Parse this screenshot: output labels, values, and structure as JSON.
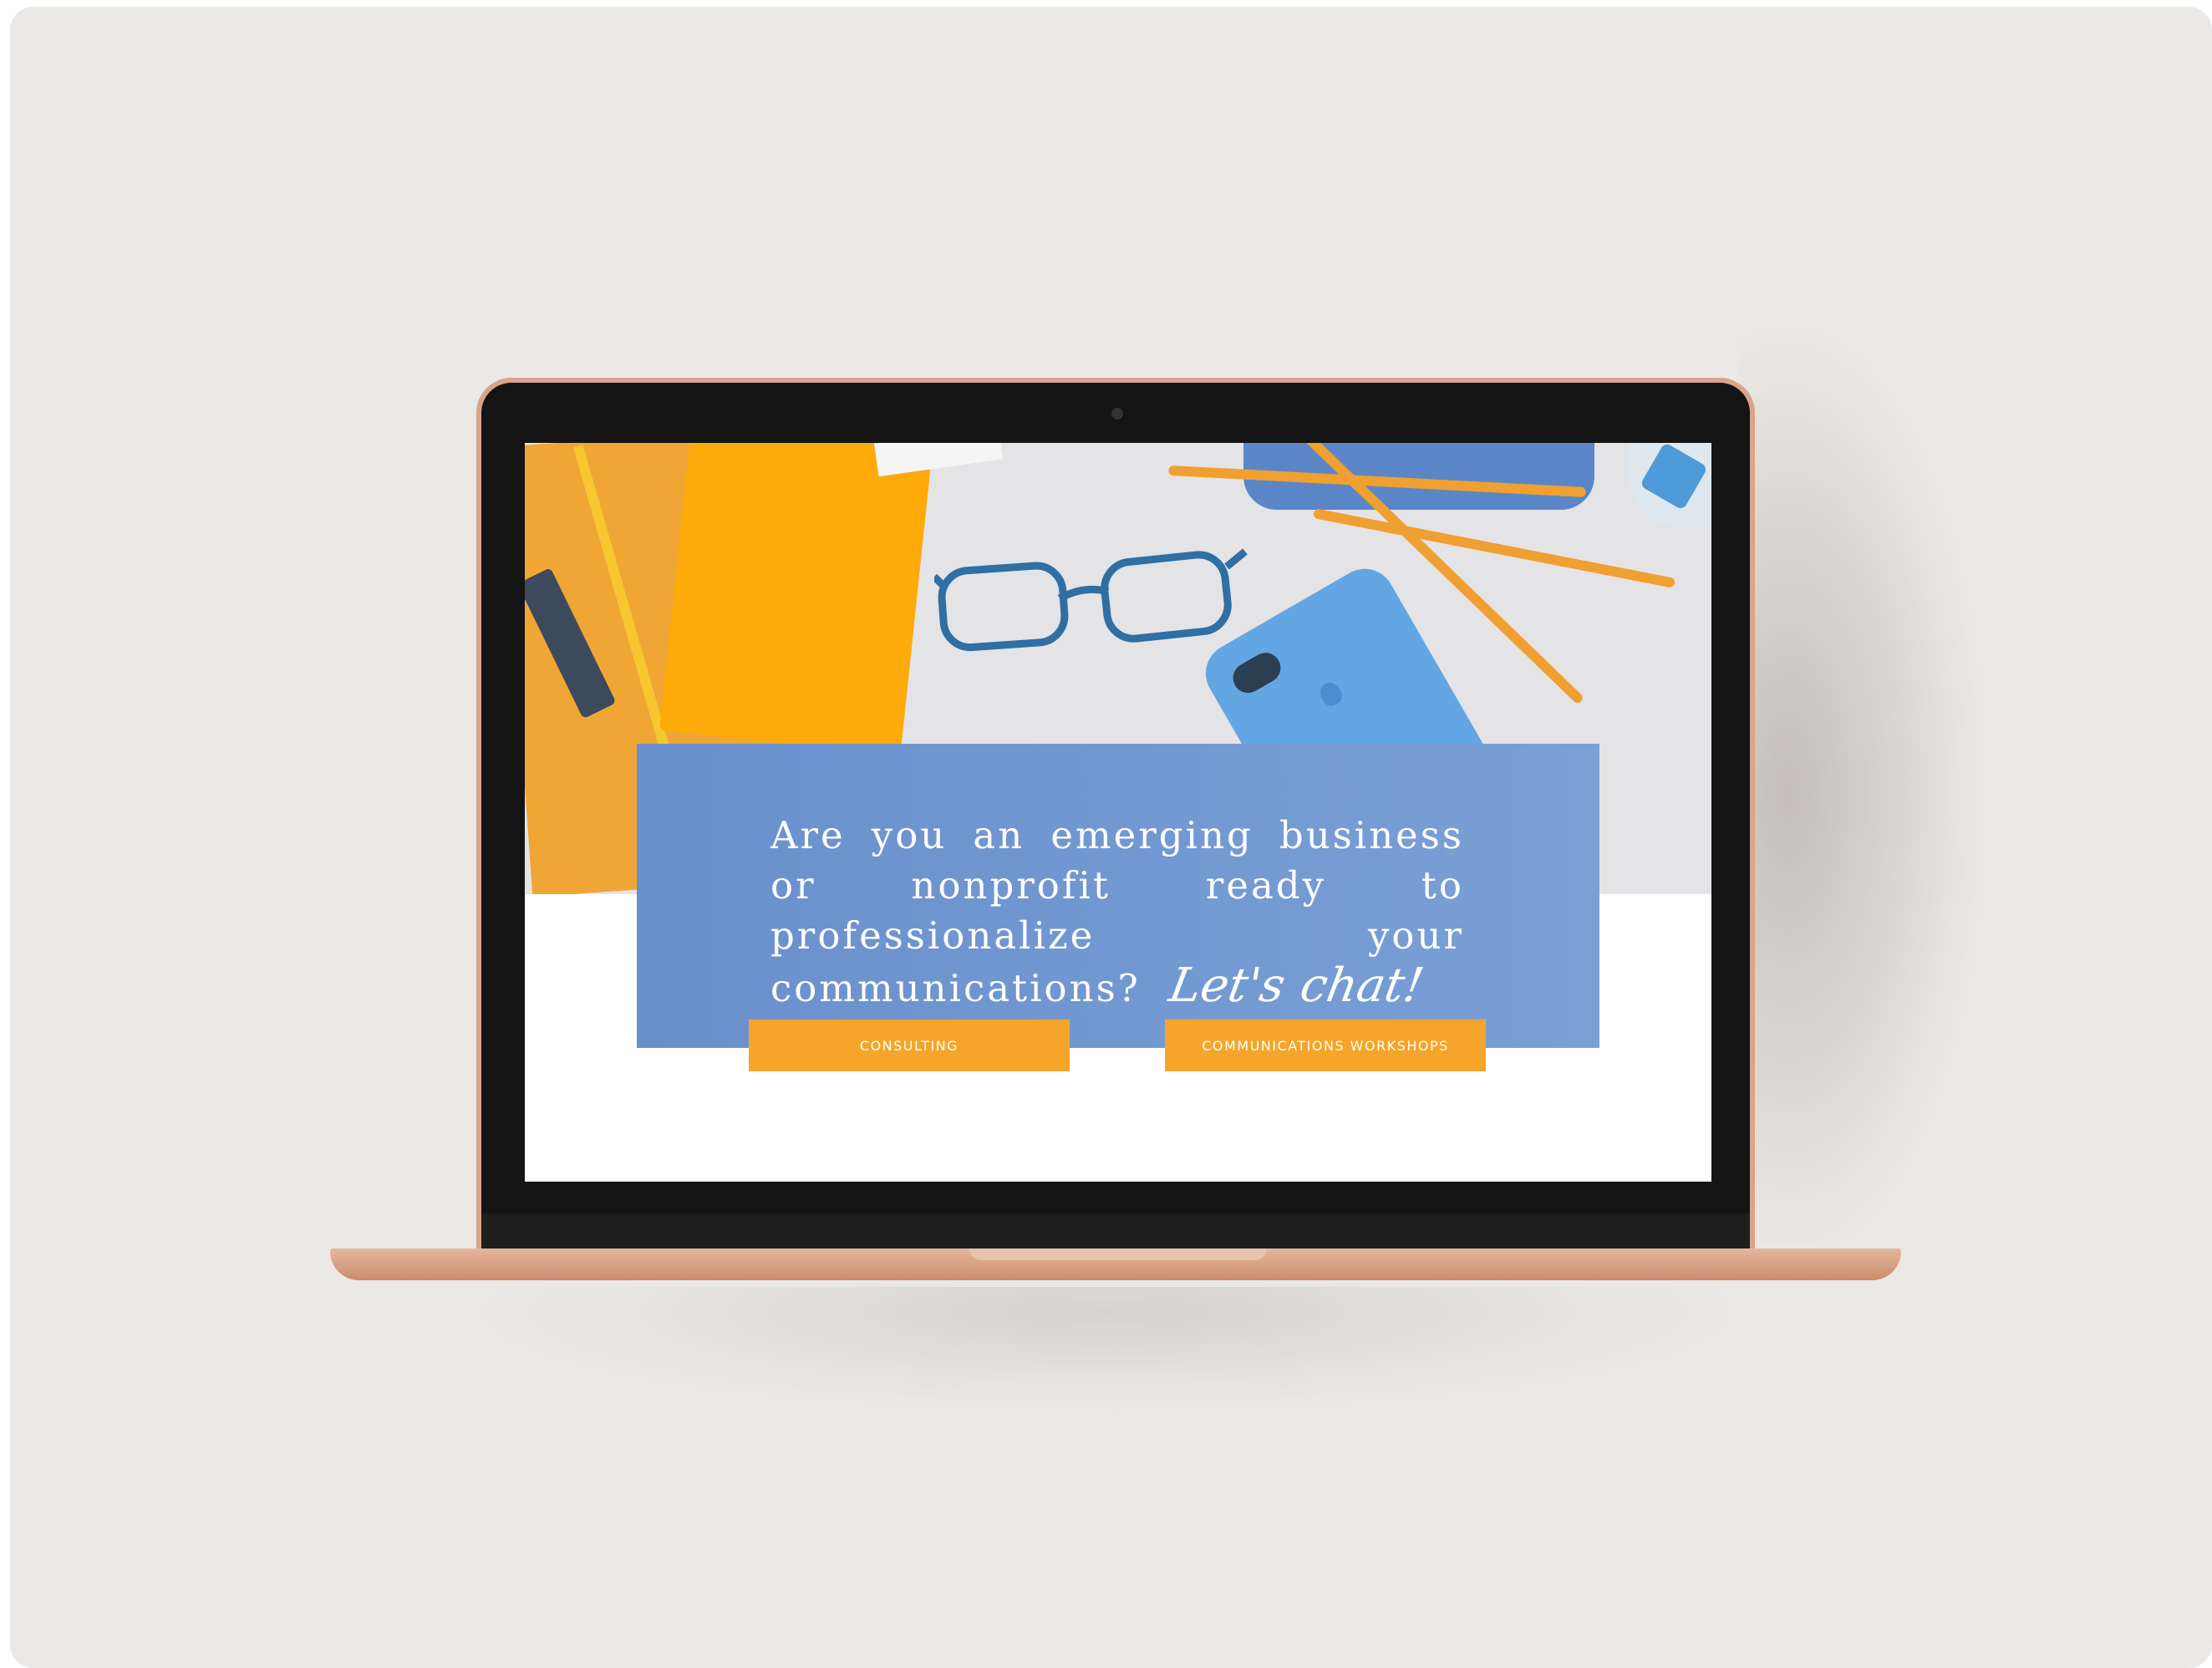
{
  "hero": {
    "headline": "Are you an emerging business or nonprofit ready to professionalize your communications?",
    "script": "Let's chat!"
  },
  "buttons": [
    {
      "label": "CONSULTING"
    },
    {
      "label": "COMMUNICATIONS WORKSHOPS"
    }
  ],
  "colors": {
    "panel_blue": "#7397d0",
    "button_orange": "#f4a52a",
    "laptop_gold": "#d9a589"
  }
}
